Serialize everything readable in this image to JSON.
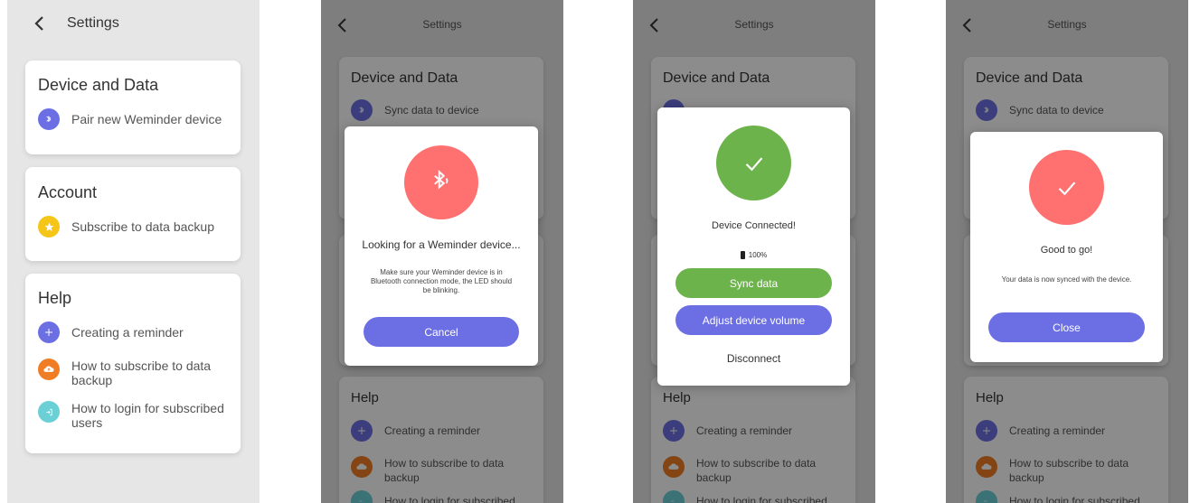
{
  "colors": {
    "purple": "#6c6fe3",
    "red": "#ff7070",
    "green": "#6db34b",
    "yellow": "#f5c518",
    "orange": "#f07d24",
    "teal": "#6bd0d6"
  },
  "settings": {
    "title": "Settings",
    "device_card": {
      "title": "Device and Data",
      "item": "Pair new Weminder device",
      "item_synced": "Sync data to device"
    },
    "account_card": {
      "title": "Account",
      "item": "Subscribe to data backup"
    },
    "help_card": {
      "title": "Help",
      "items": [
        "Creating a reminder",
        "How to subscribe to data backup",
        "How to login for subscribed users"
      ]
    }
  },
  "searching_modal": {
    "heading": "Looking for a Weminder device...",
    "body": "Make sure your Weminder device is in Bluetooth connection mode, the LED should be blinking.",
    "cancel": "Cancel"
  },
  "connected_modal": {
    "heading": "Device Connected!",
    "battery": "100%",
    "sync": "Sync data",
    "volume": "Adjust device volume",
    "disconnect": "Disconnect"
  },
  "done_modal": {
    "heading": "Good to go!",
    "body": "Your data is now synced with the device.",
    "close": "Close"
  }
}
